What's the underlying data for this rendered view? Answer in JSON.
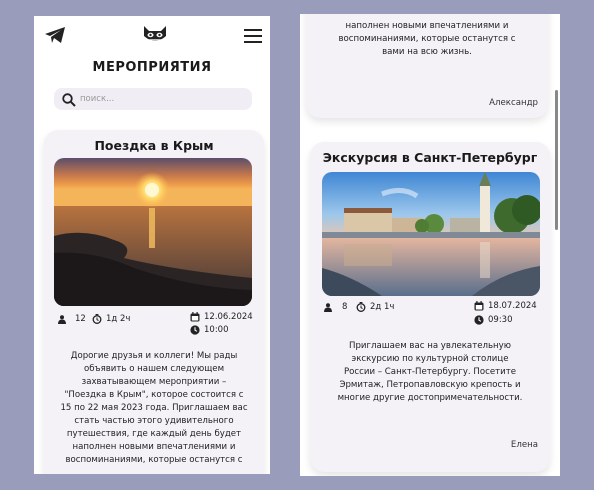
{
  "app": {
    "title": "МЕРОПРИЯТИЯ",
    "icons": {
      "left": "telegram-icon",
      "center": "raccoon-logo-icon",
      "right": "hamburger-menu-icon"
    }
  },
  "search": {
    "placeholder": "поиск..."
  },
  "colors": {
    "background": "#9a9cbb",
    "card": "#f4f1f7",
    "search": "#f0edf4"
  },
  "events": [
    {
      "title": "Поездка в Крым",
      "image": "sunset-sea-photo",
      "participants": "12",
      "duration": "1д 2ч",
      "date": "12.06.2024",
      "time": "10:00",
      "description_lines": [
        "Дорогие друзья и коллеги! Мы рады",
        "объявить о нашем следующем",
        "захватывающем мероприятии –",
        "\"Поездка в Крым\", которое состоится с",
        "15 по 22 мая 2023 года. Приглашаем вас",
        "стать частью этого удивительного",
        "путешествия, где каждый день будет",
        "наполнен новыми впечатлениями и",
        "воспоминаниями, которые останутся с"
      ],
      "description_tail_lines": [
        "наполнен новыми впечатлениями и",
        "воспоминаниями, которые останутся с",
        "вами на всю жизнь."
      ],
      "author": "Александр"
    },
    {
      "title": "Экскурсия в Санкт-Петербург",
      "image": "saint-petersburg-canal-photo",
      "participants": "8",
      "duration": "2д 1ч",
      "date": "18.07.2024",
      "time": "09:30",
      "description_lines": [
        "Приглашаем вас на увлекательную",
        "экскурсию по культурной столице",
        "России – Санкт-Петербургу. Посетите",
        "Эрмитаж, Петропавловскую крепость и",
        "многие другие достопримечательности."
      ],
      "author": "Елена"
    }
  ]
}
